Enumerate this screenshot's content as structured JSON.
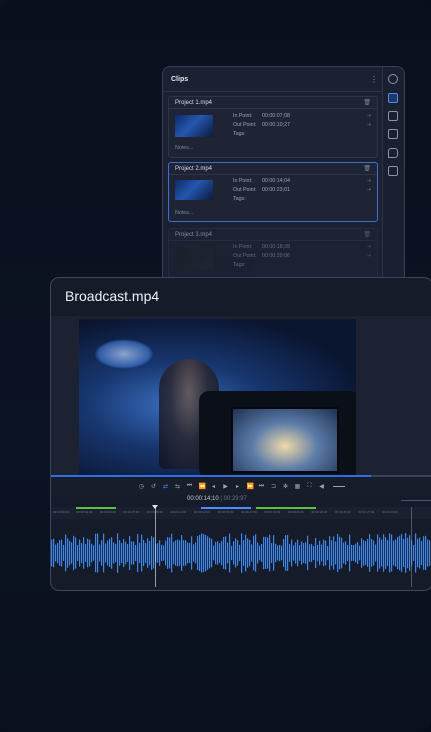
{
  "clips_panel": {
    "title": "Clips",
    "clips": [
      {
        "name": "Project 1.mp4",
        "in_label": "In Point:",
        "in_value": "00:00:07;08",
        "out_label": "Out Point:",
        "out_value": "00:00:10;27",
        "tags_label": "Tags:",
        "notes": "Notes..."
      },
      {
        "name": "Project 2.mp4",
        "in_label": "In Point:",
        "in_value": "00:00:14;04",
        "out_label": "Out Point:",
        "out_value": "00:00:23;01",
        "tags_label": "Tags:",
        "notes": "Notes..."
      },
      {
        "name": "Project 3.mp4",
        "in_label": "In Point:",
        "in_value": "00:00:18;28",
        "out_label": "Out Point:",
        "out_value": "00:00:39;06",
        "tags_label": "Tags:"
      }
    ]
  },
  "player": {
    "title": "Broadcast.mp4",
    "progress": 0.84,
    "timecode": "00:00:14;10",
    "duration": "00:29:97"
  },
  "ruler_ticks": [
    "00:00:00;00",
    "00:00:02;29",
    "00:00:04;29",
    "00:00:07;00",
    "00:00:08;29",
    "00:00:11;00",
    "00:00:13;00",
    "00:00:15;00",
    "00:00:17;00",
    "00:00:19;00",
    "00:00:21;00",
    "00:00:23;00",
    "00:00:25;00",
    "00:00:27;00",
    "00:00:29;00"
  ],
  "colors": {
    "accent": "#4b8dff",
    "marker_green": "#5cc23a",
    "waveform": "#3f86e8"
  }
}
